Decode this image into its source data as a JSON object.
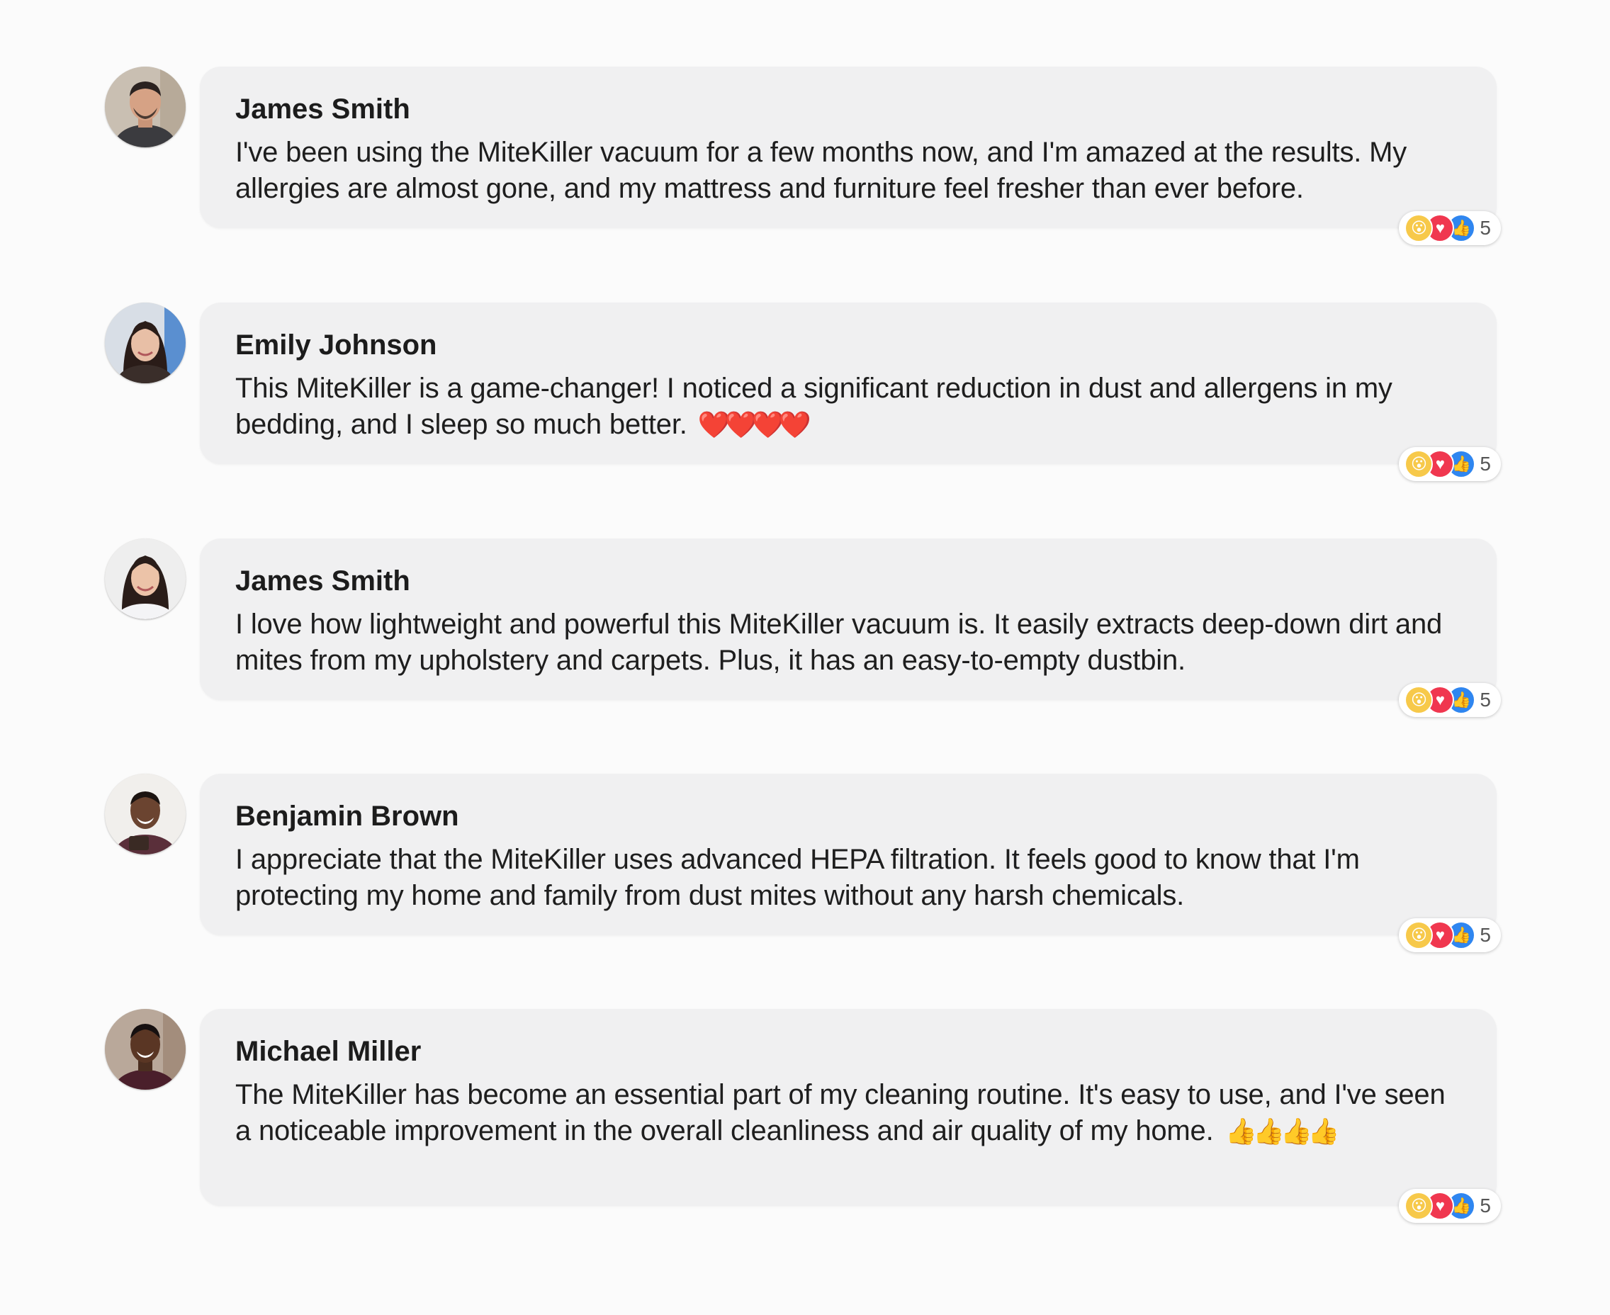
{
  "comments": [
    {
      "author": "James Smith",
      "text": "I've been using the MiteKiller vacuum for a few months now, and I'm amazed at the results. My allergies are almost gone, and my mattress and furniture feel fresher than ever before.",
      "trailing_emoji": "",
      "reactions": {
        "icons": [
          "wow",
          "love",
          "like"
        ],
        "count": "5"
      }
    },
    {
      "author": "Emily Johnson",
      "text": "This MiteKiller is a game-changer! I noticed a significant reduction in dust and allergens in my bedding, and I sleep so much better.",
      "trailing_emoji": "❤️❤️❤️❤️",
      "reactions": {
        "icons": [
          "wow",
          "love",
          "like"
        ],
        "count": "5"
      }
    },
    {
      "author": "James Smith",
      "text": "I love how lightweight and powerful this MiteKiller vacuum is. It easily extracts deep-down dirt and mites from my upholstery and carpets. Plus, it has an easy-to-empty dustbin.",
      "trailing_emoji": "",
      "reactions": {
        "icons": [
          "wow",
          "love",
          "like"
        ],
        "count": "5"
      }
    },
    {
      "author": "Benjamin Brown",
      "text": "I appreciate that the MiteKiller uses advanced HEPA filtration. It feels good to know that I'm protecting my home and family from dust mites without any harsh chemicals.",
      "trailing_emoji": "",
      "reactions": {
        "icons": [
          "wow",
          "love",
          "like"
        ],
        "count": "5"
      }
    },
    {
      "author": "Michael Miller",
      "text": "The MiteKiller has become an essential part of my cleaning routine. It's easy to use, and I've seen a noticeable improvement in the overall cleanliness and air quality of my home.",
      "trailing_emoji": "👍👍👍👍",
      "reactions": {
        "icons": [
          "wow",
          "love",
          "like"
        ],
        "count": "5"
      }
    }
  ],
  "reaction_glyphs": {
    "wow": "😮",
    "love": "♥",
    "like": "👍"
  },
  "colors": {
    "bubble": "#f0f0f1",
    "wow": "#f7c94a",
    "love": "#f0374f",
    "like": "#2f86f0"
  }
}
